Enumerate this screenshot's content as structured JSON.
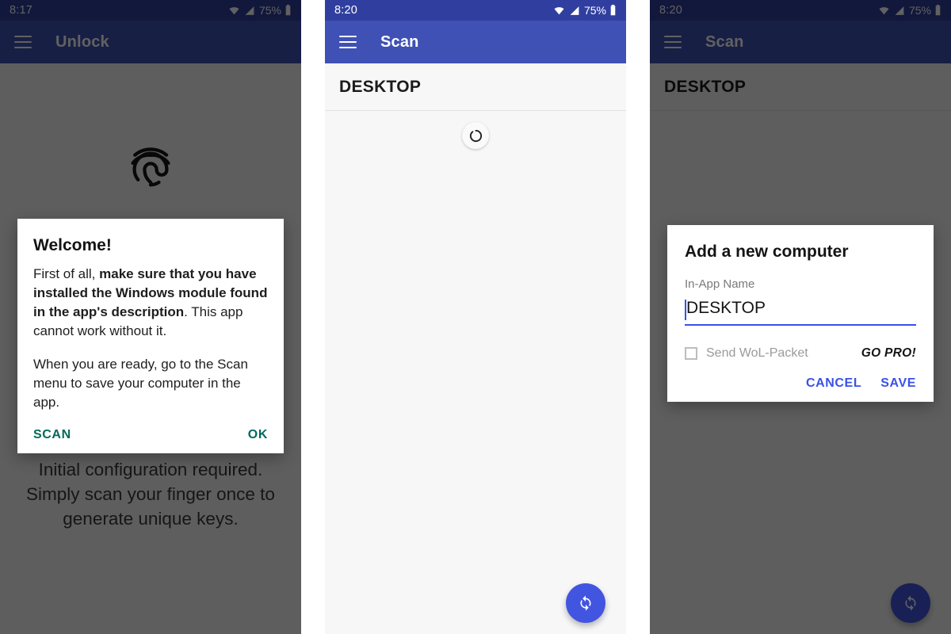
{
  "panels": [
    {
      "id": "unlock-panel",
      "status_bar": {
        "time": "8:17",
        "battery_percent": "75%",
        "wifi_icon": "wifi-icon",
        "signal_icon": "signal-icon",
        "battery_icon": "battery-icon"
      },
      "app_bar": {
        "menu_icon": "hamburger-menu-icon",
        "title": "Unlock"
      },
      "fingerprint_icon": "fingerprint-icon",
      "caption": "Initial configuration required. Simply scan your finger once to generate unique keys.",
      "dialog": {
        "title": "Welcome!",
        "paragraph1_lead": "First of all, ",
        "paragraph1_bold": "make sure that you have installed the Windows module found in the app's description",
        "paragraph1_tail": ". This app cannot work without it.",
        "paragraph2": "When you are ready, go to the Scan menu to save your computer in the app.",
        "button_left": "SCAN",
        "button_right": "OK",
        "accent_color": "#00695c"
      }
    },
    {
      "id": "scan-panel",
      "status_bar": {
        "time": "8:20",
        "battery_percent": "75%",
        "wifi_icon": "wifi-icon",
        "signal_icon": "signal-icon",
        "battery_icon": "battery-icon"
      },
      "app_bar": {
        "menu_icon": "hamburger-menu-icon",
        "title": "Scan"
      },
      "list": [
        {
          "label": "DESKTOP"
        }
      ],
      "refresh_indicator_icon": "refresh-spinner-icon",
      "fab": {
        "icon": "sync-refresh-icon",
        "color": "#4255e0"
      }
    },
    {
      "id": "add-computer-panel",
      "status_bar": {
        "time": "8:20",
        "battery_percent": "75%",
        "wifi_icon": "wifi-icon",
        "signal_icon": "signal-icon",
        "battery_icon": "battery-icon"
      },
      "app_bar": {
        "menu_icon": "hamburger-menu-icon",
        "title": "Scan"
      },
      "list": [
        {
          "label": "DESKTOP"
        }
      ],
      "fab": {
        "icon": "sync-refresh-icon",
        "color": "#4255e0"
      },
      "dialog": {
        "title": "Add a new computer",
        "field_label": "In-App Name",
        "field_value": "DESKTOP",
        "field_placeholder": "In-App Name",
        "checkbox_label": "Send WoL-Packet",
        "checkbox_checked": false,
        "go_pro_label": "GO PRO!",
        "button_cancel": "CANCEL",
        "button_save": "SAVE",
        "accent_color": "#3a51e8"
      }
    }
  ],
  "theme": {
    "status_bar_color": "#303f9f",
    "app_bar_color": "#3f51b5",
    "surface_color": "#f7f7f7",
    "scrim_color": "rgba(0,0,0,0.62)"
  }
}
